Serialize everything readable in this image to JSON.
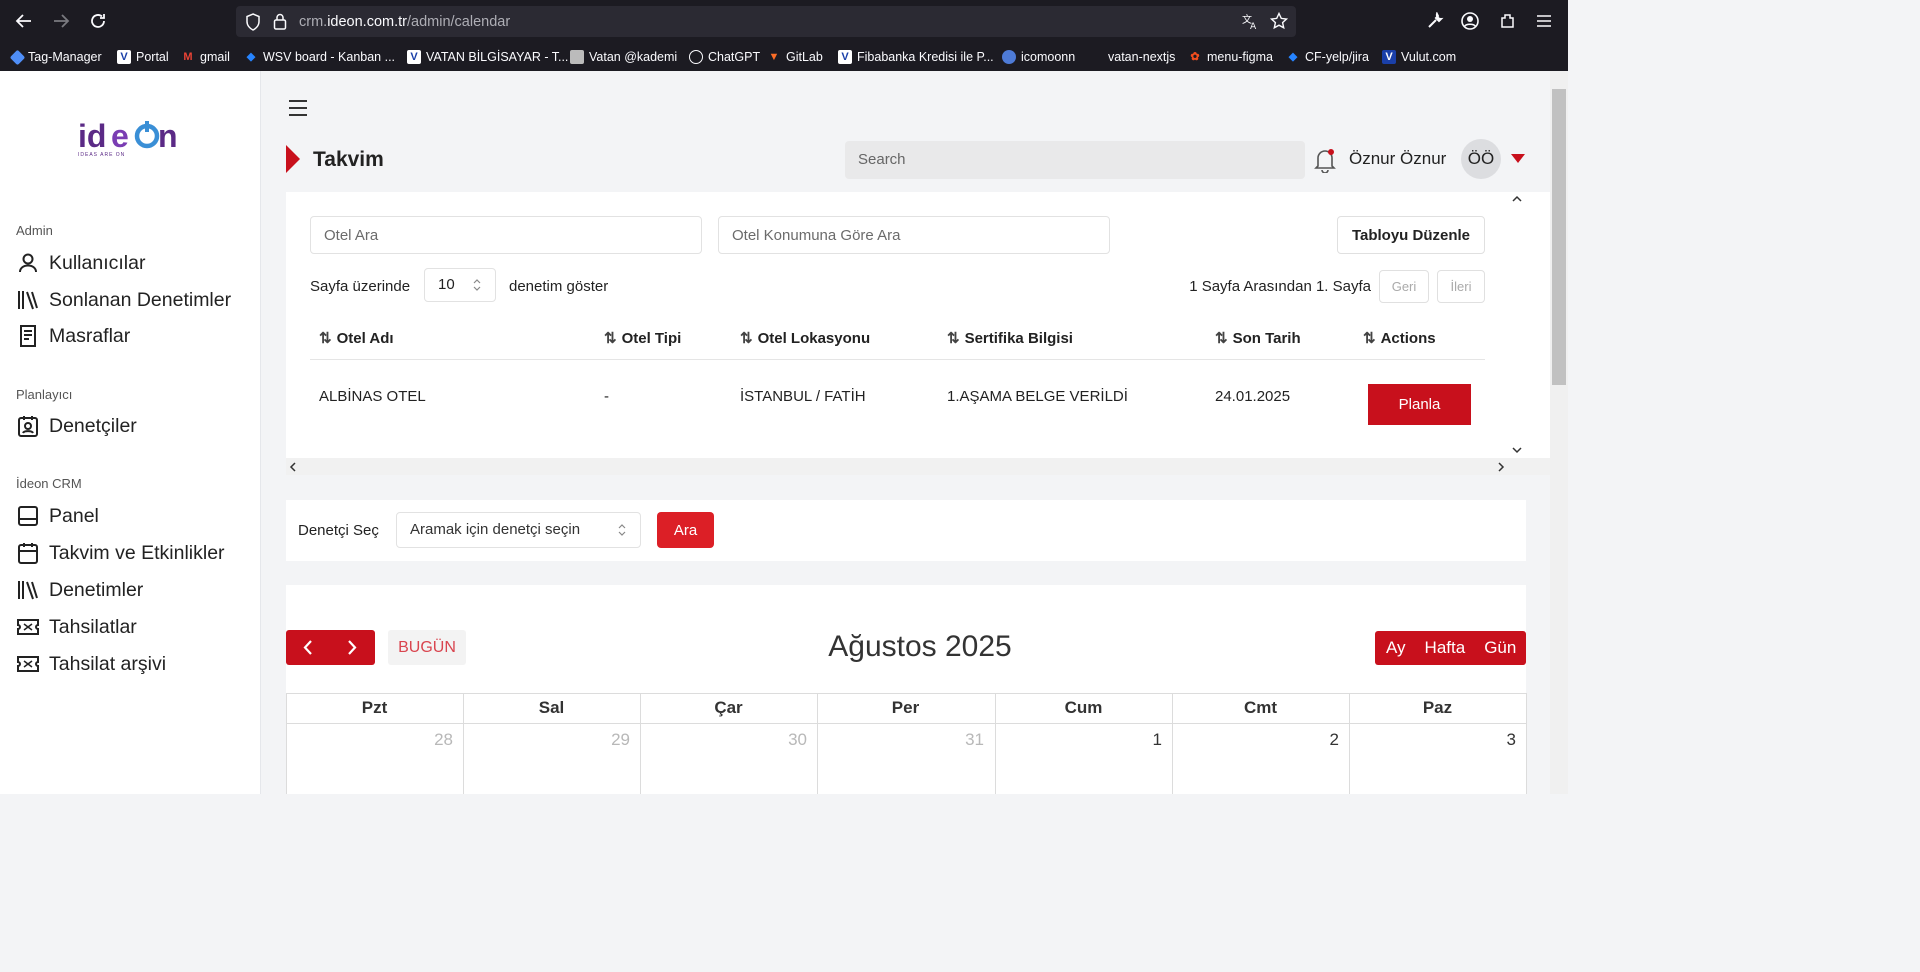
{
  "browser": {
    "url_prefix": "crm.",
    "url_domain": "ideon.com.tr",
    "url_path": "/admin/calendar",
    "bookmarks": [
      "Tag-Manager",
      "Portal",
      "gmail",
      "WSV board - Kanban ...",
      "VATAN BİLGİSAYAR - T...",
      "Vatan @kademi",
      "ChatGPT",
      "GitLab",
      "Fibabanka Kredisi ile P...",
      "icomoonn",
      "vatan-nextjs",
      "menu-figma",
      "CF-yelp/jira",
      "Vulut.com"
    ]
  },
  "sidebar": {
    "logo_tagline": "IDEAS ARE ON",
    "sections": [
      {
        "title": "Admin",
        "items": [
          "Kullanıcılar",
          "Sonlanan Denetimler",
          "Masraflar"
        ]
      },
      {
        "title": "Planlayıcı",
        "items": [
          "Denetçiler"
        ]
      },
      {
        "title": "İdeon CRM",
        "items": [
          "Panel",
          "Takvim ve Etkinlikler",
          "Denetimler",
          "Tahsilatlar",
          "Tahsilat arşivi"
        ]
      }
    ]
  },
  "header": {
    "page_title": "Takvim",
    "search_placeholder": "Search",
    "user_name": "Öznur Öznur",
    "avatar_initials": "ÖÖ"
  },
  "filters": {
    "hotel_search_placeholder": "Otel Ara",
    "location_search_placeholder": "Otel Konumuna Göre Ara",
    "edit_table_label": "Tabloyu Düzenle",
    "page_size_prefix": "Sayfa üzerinde",
    "page_size_value": "10",
    "page_size_suffix": "denetim göster",
    "pagination_text": "1 Sayfa Arasından 1. Sayfa",
    "prev_label": "Geri",
    "next_label": "İleri"
  },
  "table": {
    "columns": [
      "Otel Adı",
      "Otel Tipi",
      "Otel Lokasyonu",
      "Sertifika Bilgisi",
      "Son Tarih",
      "Actions"
    ],
    "rows": [
      {
        "name": "ALBİNAS OTEL",
        "type": "-",
        "location": "İSTANBUL / FATİH",
        "certificate": "1.AŞAMA BELGE VERİLDİ",
        "deadline": "24.01.2025",
        "action": "Planla"
      }
    ]
  },
  "inspector": {
    "label": "Denetçi Seç",
    "select_placeholder": "Aramak için denetçi seçin",
    "search_button": "Ara"
  },
  "calendar": {
    "today_label": "BUGÜN",
    "title": "Ağustos 2025",
    "views": [
      "Ay",
      "Hafta",
      "Gün"
    ],
    "weekdays": [
      "Pzt",
      "Sal",
      "Çar",
      "Per",
      "Cum",
      "Cmt",
      "Paz"
    ],
    "first_week": [
      {
        "day": "28",
        "other_month": true
      },
      {
        "day": "29",
        "other_month": true
      },
      {
        "day": "30",
        "other_month": true
      },
      {
        "day": "31",
        "other_month": true
      },
      {
        "day": "1",
        "other_month": false
      },
      {
        "day": "2",
        "other_month": false
      },
      {
        "day": "3",
        "other_month": false
      }
    ]
  },
  "colors": {
    "accent": "#c8101c",
    "chrome_bg": "#1c1b22",
    "page_bg": "#f3f4f6"
  }
}
